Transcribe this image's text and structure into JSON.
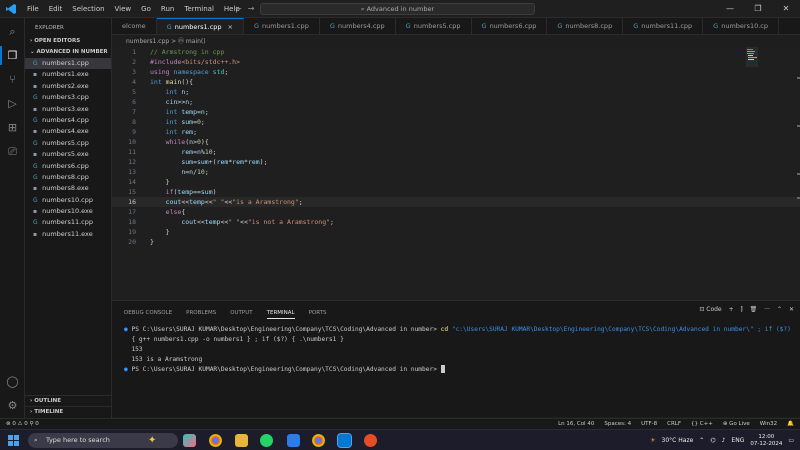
{
  "menu": [
    "File",
    "Edit",
    "Selection",
    "View",
    "Go",
    "Run",
    "Terminal",
    "Help"
  ],
  "command_center": "Advanced in number",
  "window_buttons": [
    "—",
    "❐",
    "✕"
  ],
  "explorer": {
    "title": "EXPLORER",
    "open_editors": "OPEN EDITORS",
    "folder": "ADVANCED IN NUMBER",
    "files": [
      {
        "name": "numbers1.cpp",
        "type": "cpp"
      },
      {
        "name": "numbers1.exe",
        "type": "exe"
      },
      {
        "name": "numbers2.exe",
        "type": "exe"
      },
      {
        "name": "numbers3.cpp",
        "type": "cpp"
      },
      {
        "name": "numbers3.exe",
        "type": "exe"
      },
      {
        "name": "numbers4.cpp",
        "type": "cpp"
      },
      {
        "name": "numbers4.exe",
        "type": "exe"
      },
      {
        "name": "numbers5.cpp",
        "type": "cpp"
      },
      {
        "name": "numbers5.exe",
        "type": "exe"
      },
      {
        "name": "numbers6.cpp",
        "type": "cpp"
      },
      {
        "name": "numbers8.cpp",
        "type": "cpp"
      },
      {
        "name": "numbers8.exe",
        "type": "exe"
      },
      {
        "name": "numbers10.cpp",
        "type": "cpp"
      },
      {
        "name": "numbers10.exe",
        "type": "exe"
      },
      {
        "name": "numbers11.cpp",
        "type": "cpp"
      },
      {
        "name": "numbers11.exe",
        "type": "exe"
      }
    ],
    "outline": "OUTLINE",
    "timeline": "TIMELINE"
  },
  "tabs": [
    {
      "label": "elcome",
      "active": false
    },
    {
      "label": "numbers1.cpp",
      "active": true,
      "close": "×"
    },
    {
      "label": "numbers1.cpp",
      "active": false
    },
    {
      "label": "numbers4.cpp",
      "active": false
    },
    {
      "label": "numbers5.cpp",
      "active": false
    },
    {
      "label": "numbers6.cpp",
      "active": false
    },
    {
      "label": "numbers8.cpp",
      "active": false
    },
    {
      "label": "numbers11.cpp",
      "active": false
    },
    {
      "label": "numbers10.cp",
      "active": false
    }
  ],
  "breadcrumb": "numbers1.cpp > ⓜ main()",
  "code": [
    [
      [
        "cm",
        "// Armstrong in cpp"
      ]
    ],
    [
      [
        "pp",
        "#include"
      ],
      [
        "st",
        "<bits/stdc++.h>"
      ]
    ],
    [
      [
        "pp",
        "using"
      ],
      [
        "pl",
        " "
      ],
      [
        "kw",
        "namespace"
      ],
      [
        "pl",
        " "
      ],
      [
        "ty",
        "std"
      ],
      [
        "pl",
        ";"
      ]
    ],
    [
      [
        "kw",
        "int"
      ],
      [
        "pl",
        " "
      ],
      [
        "fn",
        "main"
      ],
      [
        "pl",
        "(){"
      ]
    ],
    [
      [
        "pl",
        "    "
      ],
      [
        "kw",
        "int"
      ],
      [
        "pl",
        " "
      ],
      [
        "vr",
        "n"
      ],
      [
        "pl",
        ";"
      ]
    ],
    [
      [
        "pl",
        "    "
      ],
      [
        "vr",
        "cin"
      ],
      [
        "pl",
        ">>"
      ],
      [
        "vr",
        "n"
      ],
      [
        "pl",
        ";"
      ]
    ],
    [
      [
        "pl",
        "    "
      ],
      [
        "kw",
        "int"
      ],
      [
        "pl",
        " "
      ],
      [
        "vr",
        "temp"
      ],
      [
        "pl",
        "="
      ],
      [
        "vr",
        "n"
      ],
      [
        "pl",
        ";"
      ]
    ],
    [
      [
        "pl",
        "    "
      ],
      [
        "kw",
        "int"
      ],
      [
        "pl",
        " "
      ],
      [
        "vr",
        "sum"
      ],
      [
        "pl",
        "="
      ],
      [
        "nu",
        "0"
      ],
      [
        "pl",
        ";"
      ]
    ],
    [
      [
        "pl",
        "    "
      ],
      [
        "kw",
        "int"
      ],
      [
        "pl",
        " "
      ],
      [
        "vr",
        "rem"
      ],
      [
        "pl",
        ";"
      ]
    ],
    [
      [
        "pl",
        "    "
      ],
      [
        "pp",
        "while"
      ],
      [
        "pl",
        "("
      ],
      [
        "vr",
        "n"
      ],
      [
        "pl",
        ">"
      ],
      [
        "nu",
        "0"
      ],
      [
        "pl",
        "){"
      ]
    ],
    [
      [
        "pl",
        "        "
      ],
      [
        "vr",
        "rem"
      ],
      [
        "pl",
        "="
      ],
      [
        "vr",
        "n"
      ],
      [
        "pl",
        "%"
      ],
      [
        "nu",
        "10"
      ],
      [
        "pl",
        ";"
      ]
    ],
    [
      [
        "pl",
        "        "
      ],
      [
        "vr",
        "sum"
      ],
      [
        "pl",
        "="
      ],
      [
        "vr",
        "sum"
      ],
      [
        "pl",
        "+("
      ],
      [
        "vr",
        "rem"
      ],
      [
        "pl",
        "*"
      ],
      [
        "vr",
        "rem"
      ],
      [
        "pl",
        "*"
      ],
      [
        "vr",
        "rem"
      ],
      [
        "pl",
        ");"
      ]
    ],
    [
      [
        "pl",
        "        "
      ],
      [
        "vr",
        "n"
      ],
      [
        "pl",
        "="
      ],
      [
        "vr",
        "n"
      ],
      [
        "pl",
        "/"
      ],
      [
        "nu",
        "10"
      ],
      [
        "pl",
        ";"
      ]
    ],
    [
      [
        "pl",
        "    }"
      ]
    ],
    [
      [
        "pl",
        "    "
      ],
      [
        "pp",
        "if"
      ],
      [
        "pl",
        "("
      ],
      [
        "vr",
        "temp"
      ],
      [
        "pl",
        "=="
      ],
      [
        "vr",
        "sum"
      ],
      [
        "pl",
        ")"
      ]
    ],
    [
      [
        "pl",
        "    "
      ],
      [
        "vr",
        "cout"
      ],
      [
        "pl",
        "<<"
      ],
      [
        "vr",
        "temp"
      ],
      [
        "pl",
        "<<"
      ],
      [
        "st",
        "\" \""
      ],
      [
        "pl",
        "<<"
      ],
      [
        "st",
        "\"is a Aramstrong\""
      ],
      [
        "pl",
        ";"
      ]
    ],
    [
      [
        "pl",
        "    "
      ],
      [
        "pp",
        "else"
      ],
      [
        "pl",
        "{"
      ]
    ],
    [
      [
        "pl",
        "        "
      ],
      [
        "vr",
        "cout"
      ],
      [
        "pl",
        "<<"
      ],
      [
        "vr",
        "temp"
      ],
      [
        "pl",
        "<<"
      ],
      [
        "st",
        "\" \""
      ],
      [
        "pl",
        "<<"
      ],
      [
        "st",
        "\"is not a Aramstrong\""
      ],
      [
        "pl",
        ";"
      ]
    ],
    [
      [
        "pl",
        "    }"
      ]
    ],
    [
      [
        "pl",
        "}"
      ]
    ]
  ],
  "current_line": 16,
  "panel": {
    "tabs": [
      "DEBUG CONSOLE",
      "PROBLEMS",
      "OUTPUT",
      "TERMINAL",
      "PORTS"
    ],
    "active_tab": "TERMINAL",
    "shell_label": "Code",
    "terminal": {
      "line1_prompt": "PS C:\\Users\\SURAJ KUMAR\\Desktop\\Engineering\\Company\\TCS\\Coding\\Advanced in number> ",
      "line1_cmd": "cd",
      "line1_rest": " \"c:\\Users\\SURAJ KUMAR\\Desktop\\Engineering\\Company\\TCS\\Coding\\Advanced in number\\\" ; if ($?)",
      "line2": "{ g++ numbers1.cpp -o numbers1 } ; if ($?) { .\\numbers1 }",
      "line3": "153",
      "line4": "153 is a Aramstrong",
      "line5_prompt": "PS C:\\Users\\SURAJ KUMAR\\Desktop\\Engineering\\Company\\TCS\\Coding\\Advanced in number> "
    }
  },
  "status": {
    "left": "⊗ 0 ⚠ 0   ⚲ 0",
    "items": [
      "Ln 16, Col 40",
      "Spaces: 4",
      "UTF-8",
      "CRLF",
      "{} C++",
      "⊕ Go Live",
      "Win32",
      "🔔"
    ]
  },
  "taskbar": {
    "search_placeholder": "Type here to search",
    "weather": "30°C  Haze",
    "lang": "ENG",
    "time": "12:00",
    "date": "07-12-2024"
  }
}
